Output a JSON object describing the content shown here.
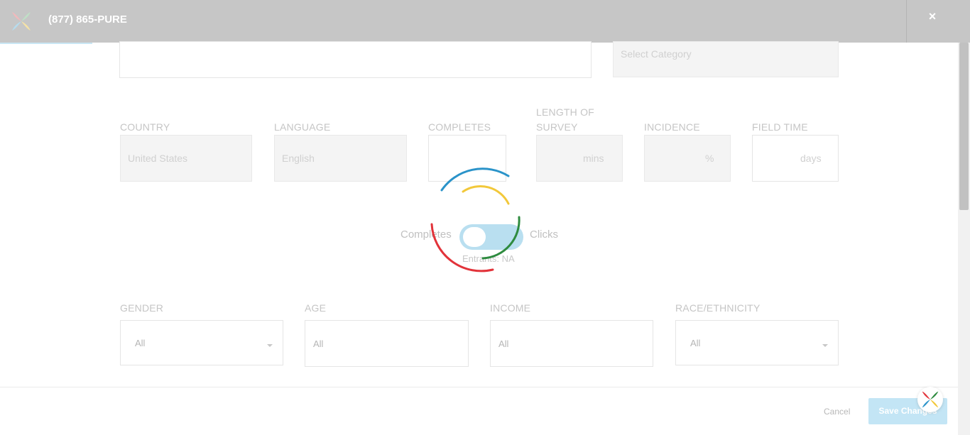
{
  "header": {
    "phone": "(877) 865-PURE",
    "close_symbol": "×"
  },
  "form": {
    "category": {
      "placeholder": "Select Category"
    },
    "country": {
      "label": "COUNTRY",
      "value": "United States"
    },
    "language": {
      "label": "LANGUAGE",
      "value": "English"
    },
    "completes": {
      "label": "COMPLETES",
      "value": ""
    },
    "length_of_survey": {
      "label_line1": "LENGTH OF",
      "label_line2": "SURVEY",
      "unit": "mins"
    },
    "incidence": {
      "label": "INCIDENCE",
      "unit": "%"
    },
    "field_time": {
      "label": "FIELD TIME",
      "unit": "days"
    },
    "toggle": {
      "left_label": "Completes",
      "right_label": "Clicks",
      "entrants": "Entrants: NA"
    },
    "gender": {
      "label": "GENDER",
      "value": "All"
    },
    "age": {
      "label": "AGE",
      "value": "All"
    },
    "income": {
      "label": "INCOME",
      "value": "All"
    },
    "race": {
      "label": "RACE/ETHNICITY",
      "value": "All"
    }
  },
  "footer": {
    "cancel": "Cancel",
    "save": "Save Changes"
  },
  "icons": {
    "logo": "brand-x-logo-icon",
    "close": "close-icon",
    "spinner": "loading-spinner-icon",
    "caret": "chevron-down-icon"
  },
  "colors": {
    "spinner_blue": "#2a93c9",
    "spinner_yellow": "#f2c83a",
    "spinner_green": "#2e8b3f",
    "spinner_red": "#e2333a",
    "toggle_track": "#b9dff0",
    "save_button": "#c3e5f5"
  }
}
